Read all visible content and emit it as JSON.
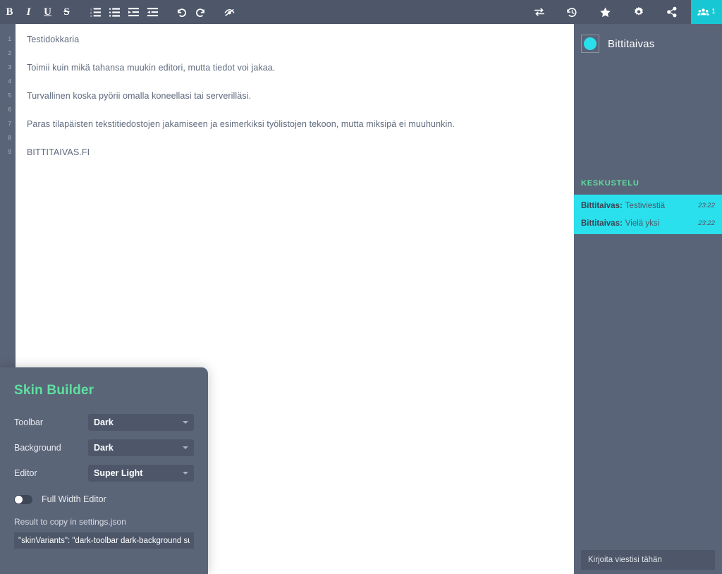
{
  "toolbar": {
    "left_buttons": [
      {
        "name": "bold-icon",
        "label": "B"
      },
      {
        "name": "italic-icon",
        "label": "I"
      },
      {
        "name": "underline-icon",
        "label": "U"
      },
      {
        "name": "strikethrough-icon",
        "label": "S"
      },
      {
        "name": "ordered-list-icon",
        "label": ""
      },
      {
        "name": "unordered-list-icon",
        "label": ""
      },
      {
        "name": "indent-icon",
        "label": ""
      },
      {
        "name": "outdent-icon",
        "label": ""
      },
      {
        "name": "undo-icon",
        "label": ""
      },
      {
        "name": "redo-icon",
        "label": ""
      },
      {
        "name": "eye-slash-icon",
        "label": ""
      }
    ],
    "right_buttons": [
      {
        "name": "transfer-icon",
        "label": ""
      },
      {
        "name": "history-icon",
        "label": ""
      },
      {
        "name": "star-icon",
        "label": ""
      },
      {
        "name": "gear-icon",
        "label": ""
      },
      {
        "name": "share-icon",
        "label": ""
      }
    ],
    "collaborators_count": "1",
    "active_accent": "#17c7d4"
  },
  "editor": {
    "line_numbers": [
      "1",
      "2",
      "3",
      "4",
      "5",
      "6",
      "7",
      "8",
      "9"
    ],
    "lines": [
      "Testidokkaria",
      "",
      "Toimii kuin mikä tahansa muukin editori, mutta tiedot voi jakaa.",
      "",
      "Turvallinen koska pyörii omalla koneellasi tai serverilläsi.",
      "",
      "Paras tilapäisten tekstitiedostojen jakamiseen ja esimerkiksi työlistojen tekoon, mutta miksipä ei muuhunkin.",
      "",
      "BITTITAIVAS.FI"
    ]
  },
  "sidebar": {
    "user_name": "Bittitaivas",
    "avatar_color": "#2ae0ec",
    "chat_heading": "KESKUSTELU",
    "chat_heading_color": "#5ee0a0",
    "chat_highlight_color": "#2ae0ec",
    "messages": [
      {
        "from": "Bittitaivas:",
        "text": "Testiviestiä",
        "time": "23:22"
      },
      {
        "from": "Bittitaivas:",
        "text": "Vielä yksi",
        "time": "23:22"
      }
    ],
    "input_placeholder": "Kirjoita viestisi tähän",
    "input_value": ""
  },
  "skin_builder": {
    "title": "Skin Builder",
    "title_color": "#5ee0a0",
    "rows": [
      {
        "label": "Toolbar",
        "value": "Dark"
      },
      {
        "label": "Background",
        "value": "Dark"
      },
      {
        "label": "Editor",
        "value": "Super Light"
      }
    ],
    "toggle_label": "Full Width Editor",
    "toggle_state": "off",
    "result_label": "Result to copy in settings.json",
    "result_value": "\"skinVariants\": \"dark-toolbar dark-background super-light-editor\""
  }
}
